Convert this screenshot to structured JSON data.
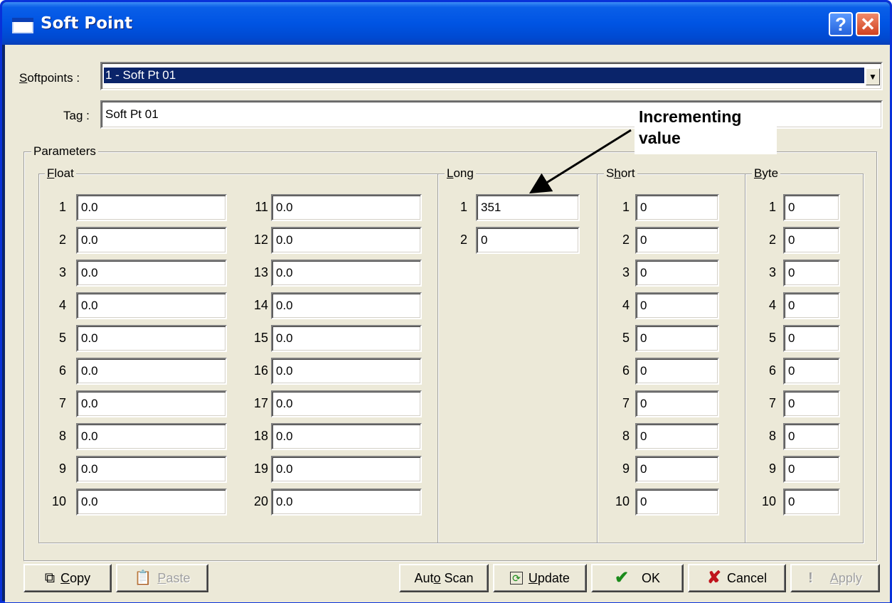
{
  "window": {
    "title": "Soft Point",
    "help_glyph": "?",
    "close_glyph": "✕"
  },
  "softpoints": {
    "label_prefix": "",
    "label_underlined": "S",
    "label_rest": "oftpoints :",
    "selected": "1 - Soft Pt 01",
    "dropdown_glyph": "▼"
  },
  "tag": {
    "label_a": "Ta",
    "label_u": "g",
    "label_b": " :",
    "value": "Soft Pt 01"
  },
  "parameters": {
    "label": "Parameters",
    "float": {
      "label_u": "F",
      "label_rest": "loat",
      "rows": [
        "1",
        "2",
        "3",
        "4",
        "5",
        "6",
        "7",
        "8",
        "9",
        "10"
      ],
      "rows2": [
        "11",
        "12",
        "13",
        "14",
        "15",
        "16",
        "17",
        "18",
        "19",
        "20"
      ],
      "values": [
        "0.0",
        "0.0",
        "0.0",
        "0.0",
        "0.0",
        "0.0",
        "0.0",
        "0.0",
        "0.0",
        "0.0"
      ],
      "values2": [
        "0.0",
        "0.0",
        "0.0",
        "0.0",
        "0.0",
        "0.0",
        "0.0",
        "0.0",
        "0.0",
        "0.0"
      ]
    },
    "long": {
      "label_u": "L",
      "label_rest": "ong",
      "rows": [
        "1",
        "2"
      ],
      "values": [
        "351",
        "0"
      ]
    },
    "short": {
      "label_a": "S",
      "label_u": "h",
      "label_rest": "ort",
      "rows": [
        "1",
        "2",
        "3",
        "4",
        "5",
        "6",
        "7",
        "8",
        "9",
        "10"
      ],
      "values": [
        "0",
        "0",
        "0",
        "0",
        "0",
        "0",
        "0",
        "0",
        "0",
        "0"
      ]
    },
    "byte": {
      "label_u": "B",
      "label_rest": "yte",
      "rows": [
        "1",
        "2",
        "3",
        "4",
        "5",
        "6",
        "7",
        "8",
        "9",
        "10"
      ],
      "values": [
        "0",
        "0",
        "0",
        "0",
        "0",
        "0",
        "0",
        "0",
        "0",
        "0"
      ]
    }
  },
  "annotation": {
    "line1": "Incrementing",
    "line2": "value"
  },
  "buttons": {
    "copy": {
      "u": "C",
      "rest": "opy",
      "icon": "copy-icon",
      "enabled": true
    },
    "paste": {
      "u": "P",
      "rest": "aste",
      "icon": "paste-icon",
      "enabled": false
    },
    "autoscan": {
      "a": "Aut",
      "u": "o",
      "rest": " Scan",
      "enabled": true
    },
    "update": {
      "u": "U",
      "rest": "pdate",
      "icon": "refresh-icon",
      "enabled": true
    },
    "ok": {
      "label": "OK",
      "icon": "checkmark-icon",
      "icon_color": "#1a8a1a",
      "enabled": true
    },
    "cancel": {
      "label": "Cancel",
      "icon": "x-icon",
      "icon_color": "#c0141c",
      "enabled": true
    },
    "apply": {
      "u": "A",
      "rest": "pply",
      "icon": "exclamation-icon",
      "enabled": false
    }
  }
}
